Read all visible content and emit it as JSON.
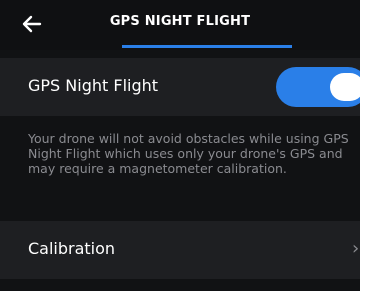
{
  "header": {
    "title": "GPS NIGHT FLIGHT",
    "back_icon": "arrow-left-icon"
  },
  "gps_night_flight": {
    "label": "GPS Night Flight",
    "enabled": true,
    "accent": "#2a7fe8"
  },
  "description": "Your drone will not avoid obstacles while using GPS Night Flight which uses only your drone's GPS and may require a magnetometer calibration.",
  "calibration": {
    "label": "Calibration",
    "chevron_icon": "chevron-right-icon"
  }
}
